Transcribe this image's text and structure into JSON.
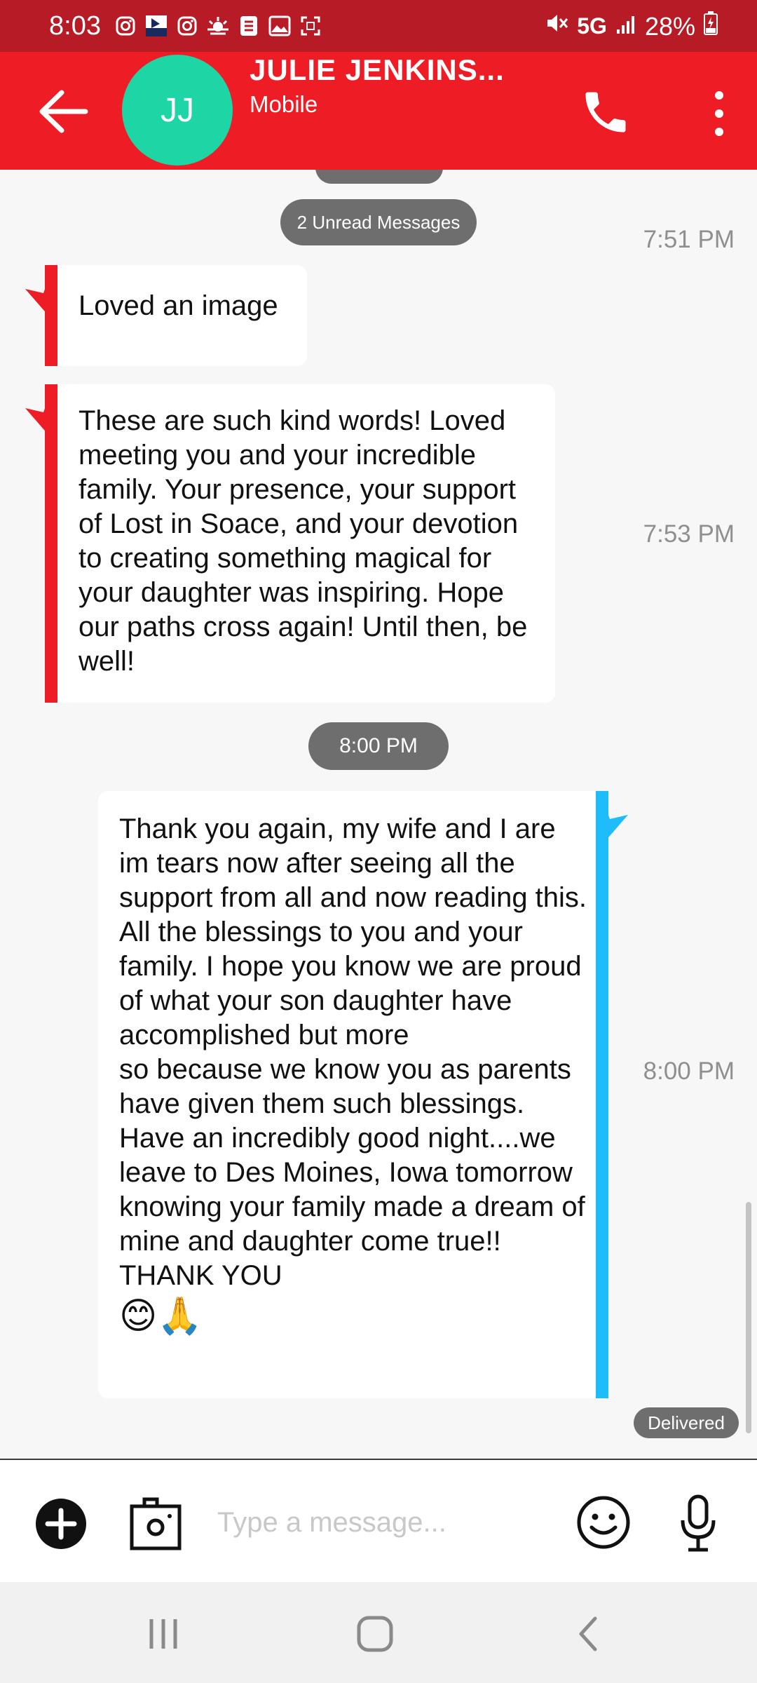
{
  "status_bar": {
    "time": "8:03",
    "network": "5G",
    "battery": "28%",
    "left_icons": [
      "instagram-icon",
      "app-icon",
      "instagram-icon",
      "weather-icon",
      "sheets-icon",
      "gallery-icon",
      "screenshot-icon"
    ],
    "right_icons": [
      "mute-icon",
      "signal-icon",
      "battery-icon"
    ]
  },
  "header": {
    "avatar_initials": "JJ",
    "contact_name": "JULIE JENKINS...",
    "contact_type": "Mobile",
    "icons": [
      "back-arrow-icon",
      "phone-icon",
      "more-vert-icon"
    ]
  },
  "chat": {
    "unread_label": "2 Unread Messages",
    "time_separator": "8:00 PM",
    "delivered_label": "Delivered",
    "messages": [
      {
        "direction": "incoming",
        "text": "Loved an image",
        "time": "7:51 PM"
      },
      {
        "direction": "incoming",
        "text": "These are such kind words! Loved meeting you and your incredible family. Your presence, your support of Lost in Soace, and your devotion to creating something magical for your daughter was inspiring. Hope our paths cross again! Until then, be well!",
        "time": "7:53 PM"
      },
      {
        "direction": "outgoing",
        "text": "Thank you again, my wife and I are im tears now after seeing all the support from all and now reading this.\nAll the blessings to you and your family. I hope you know we are proud of what your son  daughter have accomplished but more\nso because we know you as parents have given them such blessings. Have an incredibly good night....we leave to Des Moines, Iowa tomorrow knowing your family made a dream of mine and daughter come true!!  THANK YOU",
        "emojis": "😊🙏",
        "time": "8:00 PM"
      }
    ]
  },
  "composer": {
    "placeholder": "Type a message...",
    "icons": [
      "add-icon",
      "camera-icon",
      "emoji-icon",
      "microphone-icon"
    ]
  },
  "nav_bar": {
    "icons": [
      "recents-icon",
      "home-icon",
      "back-icon"
    ]
  },
  "colors": {
    "status_bar": "#b71b25",
    "app_bar": "#ee1c25",
    "avatar": "#1ed5a5",
    "incoming_accent": "#ee1c25",
    "outgoing_accent": "#1ebcf8",
    "pill": "#6e6e6e"
  }
}
